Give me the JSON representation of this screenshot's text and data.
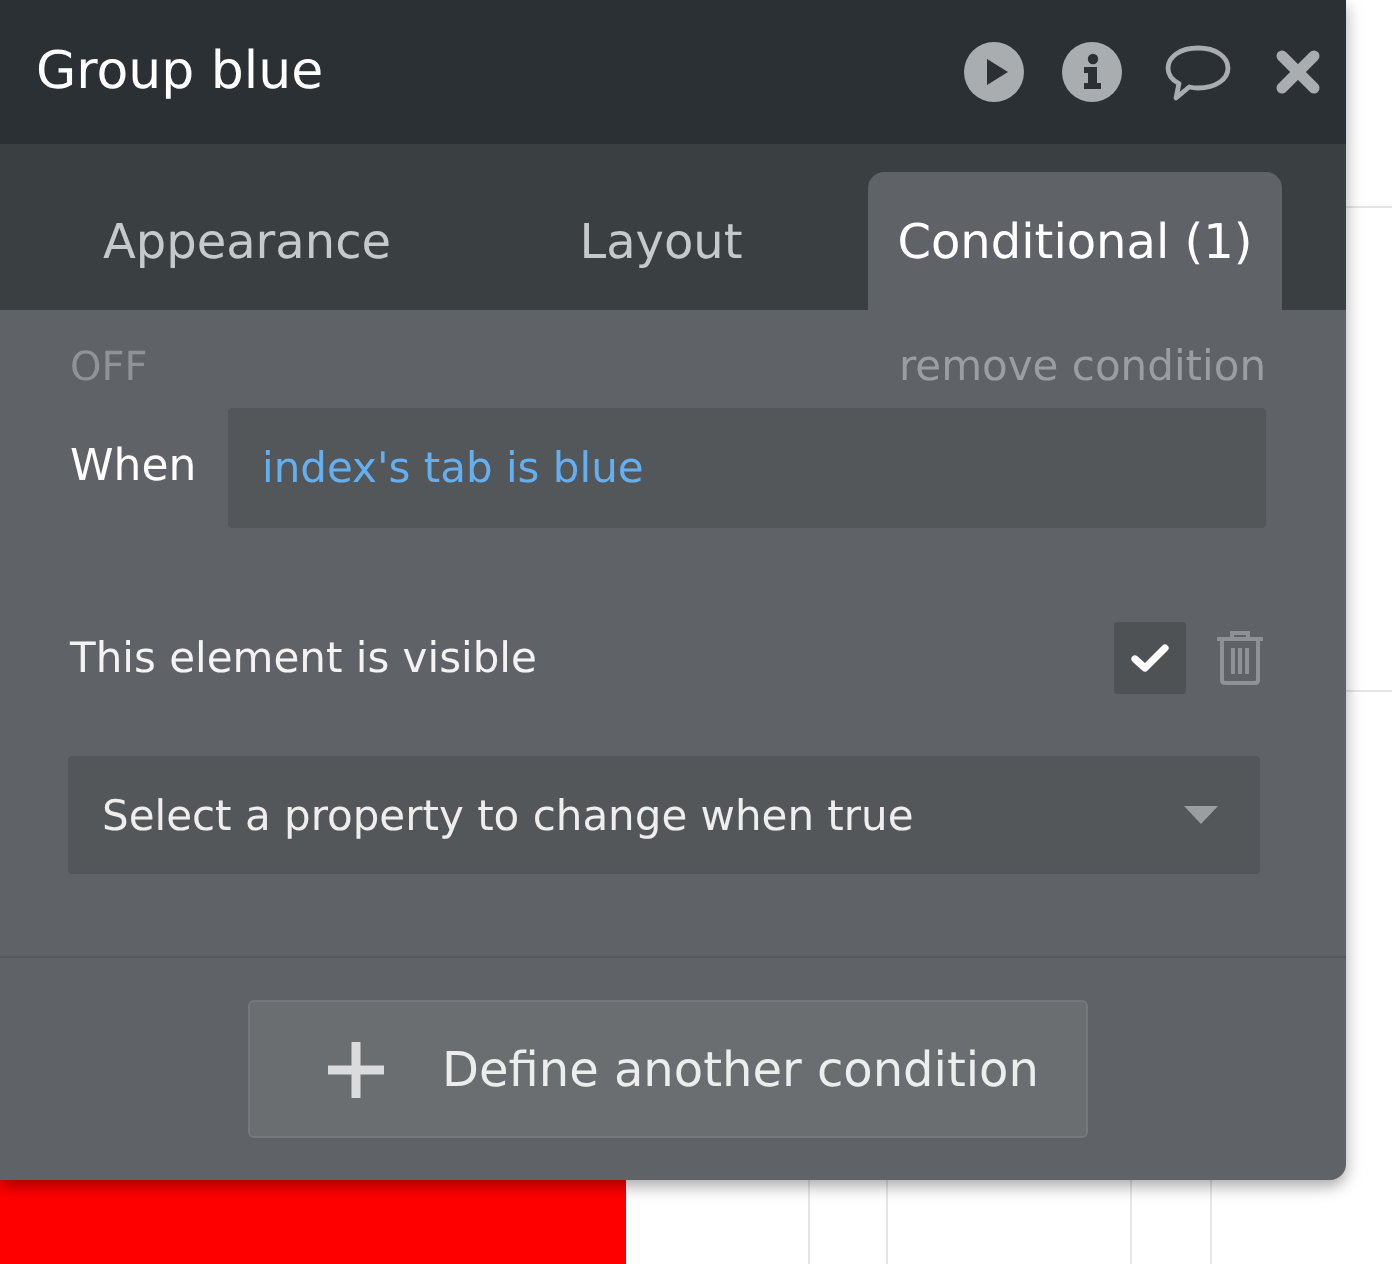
{
  "window": {
    "title": "Group blue"
  },
  "tabs": [
    {
      "label": "Appearance",
      "selected": false
    },
    {
      "label": "Layout",
      "selected": false
    },
    {
      "label": "Conditional (1)",
      "selected": true
    }
  ],
  "conditions": [
    {
      "status": "OFF",
      "remove_link": "remove condition",
      "when_label": "When",
      "expression": "index's tab is blue",
      "properties": [
        {
          "label": "This element is visible",
          "checked": true
        }
      ],
      "property_select": "Select a property to change when true"
    }
  ],
  "add_button": "Define another condition"
}
